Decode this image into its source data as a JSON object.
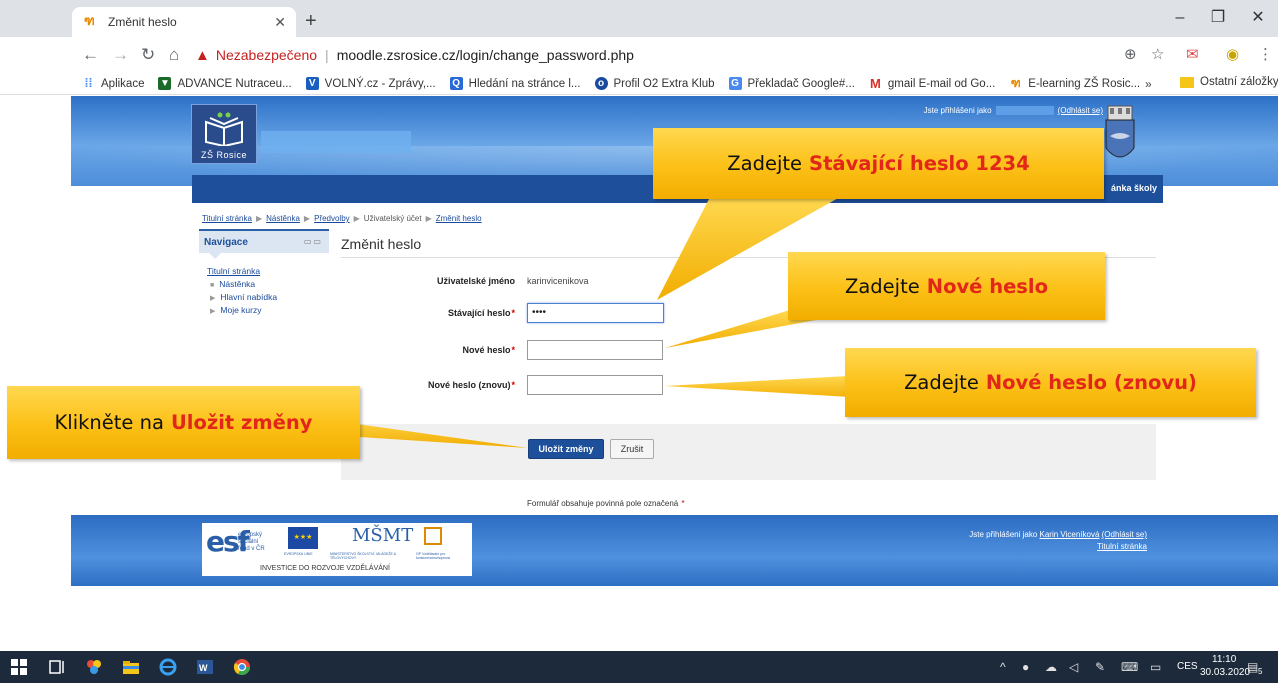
{
  "browser": {
    "tab_title": "Změnit heslo",
    "tab_favicon": "moodle-icon",
    "insecure_label": "Nezabezpečeno",
    "url": "moodle.zsrosice.cz/login/change_password.php",
    "bookmarks": [
      {
        "label": "Aplikace",
        "icon": "apps-icon",
        "color": "#4285f4"
      },
      {
        "label": "ADVANCE Nutraceu...",
        "icon": "advance-icon",
        "color": "#2a8a2a"
      },
      {
        "label": "VOLNÝ.cz - Zprávy,...",
        "icon": "volny-icon",
        "color": "#1a5fc0"
      },
      {
        "label": "Hledání na stránce l...",
        "icon": "search-icon",
        "color": "#2a6ad8"
      },
      {
        "label": "Profil O2 Extra Klub",
        "icon": "o2-icon",
        "color": "#1a4aa0"
      },
      {
        "label": "Překladač Google#...",
        "icon": "translate-icon",
        "color": "#4a8af0"
      },
      {
        "label": "gmail E-mail od Go...",
        "icon": "gmail-icon",
        "color": "#d93025"
      },
      {
        "label": "E-learning ZŠ Rosic...",
        "icon": "moodle-icon",
        "color": "#e88a00"
      }
    ],
    "bookmarks_more": "»",
    "other_bookmarks": "Ostatní záložky"
  },
  "site": {
    "logo_text": "ZŠ Rosice",
    "login_prefix": "Jste přihlášeni jako",
    "logout_link": "(Odhlásit se)",
    "navbar_text": "ánka školy",
    "breadcrumb": [
      "Titulní stránka",
      "Nástěnka",
      "Předvolby",
      "Uživatelský účet",
      "Změnit heslo"
    ],
    "nav_block": {
      "title": "Navigace",
      "home": "Titulní stránka",
      "items": [
        "Nástěnka",
        "Hlavní nabídka",
        "Moje kurzy"
      ]
    },
    "page_title": "Změnit heslo",
    "form": {
      "username_label": "Uživatelské jméno",
      "username_value": "karinvicenikova",
      "current_label": "Stávající heslo",
      "current_value": "••••",
      "new_label": "Nové heslo",
      "new_value": "",
      "repeat_label": "Nové heslo (znovu)",
      "repeat_value": "",
      "required_mark": "*",
      "save_button": "Uložit změny",
      "cancel_button": "Zrušit",
      "required_note": "Formulář obsahuje povinná pole označená"
    },
    "footer": {
      "login_text": "Jste přihlášeni jako",
      "user_name": "Karin Viceníková",
      "logout_link": "(Odhlásit se)",
      "home_link": "Titulní stránka",
      "logos_caption": "INVESTICE DO ROZVOJE VZDĚLÁVÁNÍ",
      "esf_line1": "evropský",
      "esf_line2": "sociální",
      "esf_line3": "fond v ČR",
      "eu_caption": "EVROPSKÁ UNIE",
      "msmt_caption": "MINISTERSTVO ŠKOLSTVÍ, MLÁDEŽE A TĚLOVÝCHOVY",
      "op_caption": "OP Vzdělávání pro konkurenceschopnost"
    }
  },
  "callouts": {
    "c1_prefix": "Zadejte",
    "c1_highlight": "Stávající heslo 1234",
    "c2_prefix": "Zadejte",
    "c2_highlight": "Nové heslo",
    "c3_prefix": "Zadejte",
    "c3_highlight": "Nové  heslo (znovu)",
    "c4_prefix": "Klikněte na",
    "c4_highlight": "Uložit změny"
  },
  "taskbar": {
    "language": "CES",
    "time": "11:10",
    "date": "30.03.2020",
    "notifications": "5"
  },
  "colors": {
    "accent_blue": "#1d4f9a",
    "callout_yellow": "#fcc016",
    "highlight_red": "#e3261a"
  }
}
